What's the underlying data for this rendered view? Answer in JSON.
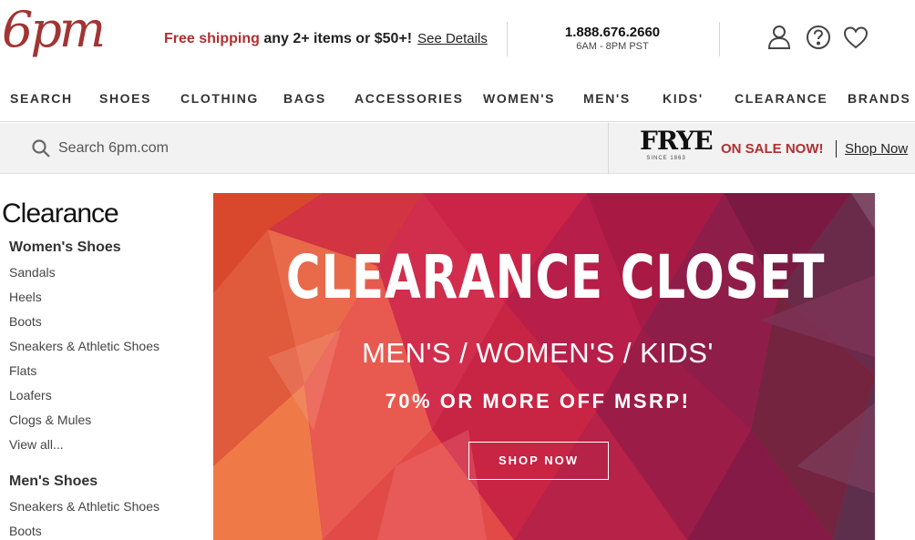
{
  "header": {
    "logo": "6pm",
    "promo_highlight": "Free shipping",
    "promo_rest": " any 2+ items or $50+!",
    "see_details": "See Details",
    "phone": "1.888.676.2660",
    "hours": "6AM - 8PM PST",
    "icons": [
      "account-icon",
      "help-icon",
      "favorites-heart-icon"
    ]
  },
  "nav": {
    "items": [
      "SEARCH",
      "SHOES",
      "CLOTHING",
      "BAGS",
      "ACCESSORIES",
      "WOMEN'S",
      "MEN'S",
      "KIDS'",
      "CLEARANCE",
      "BRANDS"
    ]
  },
  "search": {
    "placeholder": "Search 6pm.com",
    "promo_brand": "FRYE",
    "promo_since": "SINCE 1863",
    "promo_text": "ON SALE NOW!",
    "promo_link": "Shop Now"
  },
  "sidebar": {
    "title": "Clearance",
    "sections": [
      {
        "heading": "Women's Shoes",
        "links": [
          "Sandals",
          "Heels",
          "Boots",
          "Sneakers & Athletic Shoes",
          "Flats",
          "Loafers",
          "Clogs & Mules",
          "View all..."
        ]
      },
      {
        "heading": "Men's Shoes",
        "links": [
          "Sneakers & Athletic Shoes",
          "Boots"
        ]
      }
    ]
  },
  "banner": {
    "title": "CLEARANCE CLOSET",
    "subtitle": "MEN'S / WOMEN'S / KIDS'",
    "offer": "70% OR MORE OFF MSRP!",
    "button": "SHOP NOW"
  },
  "colors": {
    "brand_red": "#a23434",
    "sale_red": "#b03030",
    "nav_text": "#333333"
  }
}
